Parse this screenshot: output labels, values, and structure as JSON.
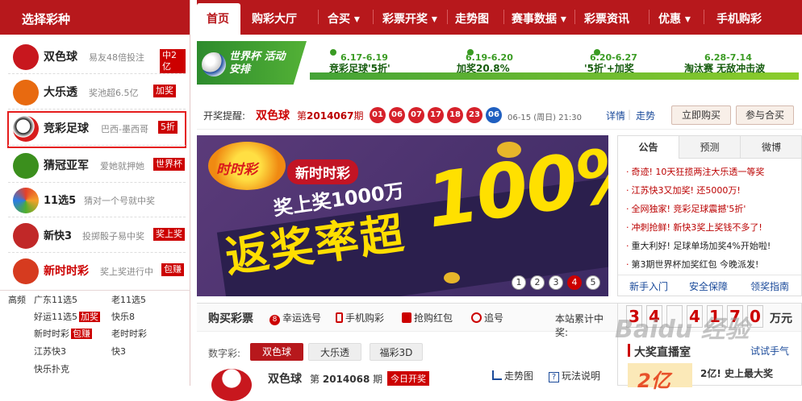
{
  "sidebar": {
    "title": "选择彩种",
    "games": [
      {
        "name": "双色球",
        "desc": "易友48倍投注",
        "badge": "中2亿",
        "logo": "双色球",
        "color": "#c8171e"
      },
      {
        "name": "大乐透",
        "desc": "奖池超6.5亿",
        "badge": "加奖",
        "logo": "大乐透",
        "color": "#e86a10"
      },
      {
        "name": "竞彩足球",
        "desc": "巴西-墨西哥",
        "badge": "5折",
        "logo": "",
        "color": "#d81c1c"
      },
      {
        "name": "猜冠亚军",
        "desc": "爱她就押她",
        "badge": "世界杯",
        "logo": "猜冠军",
        "color": "#3b8f1d"
      },
      {
        "name": "11选5",
        "desc": "猜对一个号就中奖",
        "badge": "",
        "logo": "11",
        "color": "#e4402a"
      },
      {
        "name": "新快3",
        "desc": "投掷骰子易中奖",
        "badge": "奖上奖",
        "logo": "",
        "color": "#c12828"
      },
      {
        "name": "新时时彩",
        "desc": "奖上奖进行中",
        "badge": "包赚",
        "logo": "时时彩",
        "color": "#d63b1f"
      }
    ],
    "freq_label": "高频",
    "freq_items": [
      {
        "text": "广东11选5",
        "badge": ""
      },
      {
        "text": "老11选5",
        "badge": ""
      },
      {
        "text": "好运11选5",
        "badge": "加奖"
      },
      {
        "text": "快乐8",
        "badge": ""
      },
      {
        "text": "新时时彩",
        "badge": "包赚"
      },
      {
        "text": "老时时彩",
        "badge": ""
      },
      {
        "text": "江苏快3",
        "badge": ""
      },
      {
        "text": "快3",
        "badge": ""
      },
      {
        "text": "快乐扑克",
        "badge": ""
      }
    ]
  },
  "nav": {
    "items": [
      "首页",
      "购彩大厅",
      "合买",
      "彩票开奖",
      "走势图",
      "赛事数据",
      "彩票资讯",
      "优惠",
      "手机购彩"
    ]
  },
  "worldcup": {
    "logo_text": "世界杯 活动安排",
    "phases": [
      {
        "date": "6.17-6.19",
        "title": "竞彩足球'5折'"
      },
      {
        "date": "6.19-6.20",
        "title": "加奖20.8%"
      },
      {
        "date": "6.20-6.27",
        "title": "'5折'+加奖"
      },
      {
        "date": "6.28-7.14",
        "title": "淘汰赛  无敌冲击波"
      }
    ]
  },
  "draw": {
    "label": "开奖提醒:",
    "game": "双色球",
    "period_prefix": "第",
    "period": "2014067",
    "period_suffix": "期",
    "red_balls": [
      "01",
      "06",
      "07",
      "17",
      "18",
      "23"
    ],
    "blue_ball": "06",
    "date": "06-15 (周日) 21:30",
    "detail": "详情",
    "trend": "走势",
    "buy_now": "立即购买",
    "join_group": "参与合买"
  },
  "promo": {
    "brand": "时时彩",
    "tag": "新时时彩",
    "line1": "奖上奖1000万",
    "line2": "返奖率超",
    "big": "100%",
    "pages": [
      "1",
      "2",
      "3",
      "4",
      "5"
    ],
    "active_page": "4"
  },
  "notice": {
    "tabs": [
      "公告",
      "预测",
      "微博"
    ],
    "items": [
      {
        "bullet": "·",
        "text": "奇迹! 10天狂揽两注大乐透一等奖",
        "color": "#b00"
      },
      {
        "bullet": "·",
        "text": "江苏快3又加奖! 还5000万!",
        "color": "#b00"
      },
      {
        "bullet": "·",
        "text": "全网独家! 竞彩足球震撼'5折'",
        "color": "#b00"
      },
      {
        "bullet": "·",
        "text": "冲刺抢鲜! 新快3奖上奖钱不多了!",
        "color": "#b00"
      },
      {
        "bullet": "·",
        "text": "重大利好! 足球单场加奖4%开始啦!",
        "color": "#222"
      },
      {
        "bullet": "·",
        "text": "第3期世界杯加奖红包 今晚派发!",
        "color": "#222"
      }
    ],
    "footer": [
      "新手入门",
      "安全保障",
      "领奖指南"
    ]
  },
  "buy": {
    "title": "购买彩票",
    "links": [
      "幸运选号",
      "手机购彩",
      "抢购红包",
      "追号"
    ],
    "stat_label": "本站累计中奖:",
    "digits": [
      "3",
      "4",
      "",
      "4",
      "1",
      "7",
      "0"
    ],
    "unit": "万元",
    "num_label": "数字彩:",
    "num_tabs": [
      "双色球",
      "大乐透",
      "福彩3D"
    ],
    "game_name": "双色球",
    "game_period_prefix": "第",
    "game_period": "2014068",
    "game_period_suffix": "期",
    "game_badge": "今日开奖",
    "trend_link": "走势图",
    "rules_link": "玩法说明"
  },
  "live": {
    "title": "大奖直播室",
    "try": "试试手气",
    "headline": "2亿! 史上最大奖",
    "amount": "2亿"
  },
  "watermark": "Baidu 经验"
}
